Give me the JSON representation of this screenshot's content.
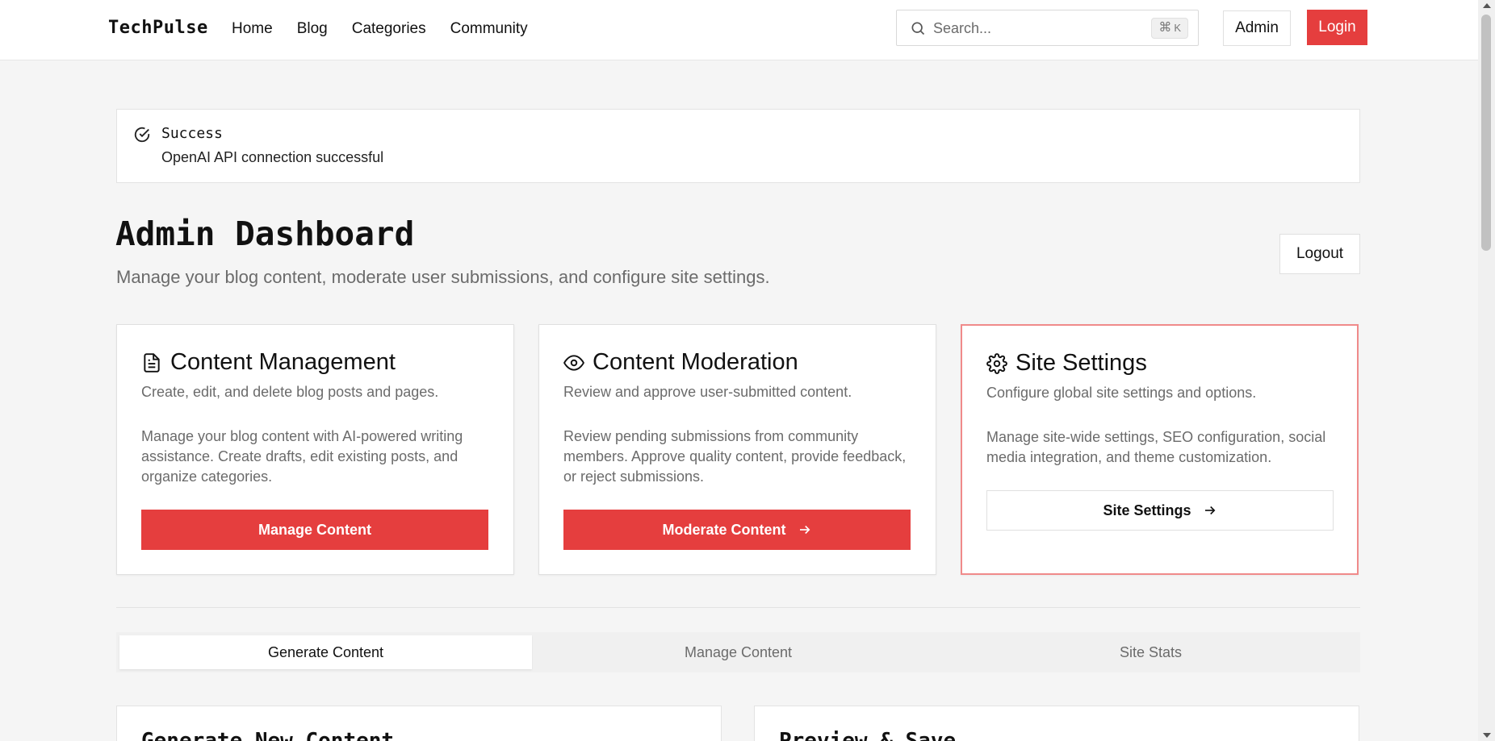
{
  "header": {
    "brand": "TechPulse",
    "nav": [
      "Home",
      "Blog",
      "Categories",
      "Community"
    ],
    "search_placeholder": "Search...",
    "shortcut_key": "K",
    "admin_label": "Admin",
    "login_label": "Login"
  },
  "alert": {
    "title": "Success",
    "message": "OpenAI API connection successful"
  },
  "page": {
    "title": "Admin Dashboard",
    "subtitle": "Manage your blog content, moderate user submissions, and configure site settings.",
    "logout_label": "Logout"
  },
  "cards": [
    {
      "title": "Content Management",
      "desc": "Create, edit, and delete blog posts and pages.",
      "body": "Manage your blog content with AI-powered writing assistance. Create drafts, edit existing posts, and organize categories.",
      "button": "Manage Content"
    },
    {
      "title": "Content Moderation",
      "desc": "Review and approve user-submitted content.",
      "body": "Review pending submissions from community members. Approve quality content, provide feedback, or reject submissions.",
      "button": "Moderate Content"
    },
    {
      "title": "Site Settings",
      "desc": "Configure global site settings and options.",
      "body": "Manage site-wide settings, SEO configuration, social media integration, and theme customization.",
      "button": "Site Settings"
    }
  ],
  "tabs": [
    "Generate Content",
    "Manage Content",
    "Site Stats"
  ],
  "panels": [
    "Generate New Content",
    "Preview & Save"
  ],
  "colors": {
    "accent": "#e53e3e",
    "accent_border": "#f08a8a",
    "background": "#f5f5f5"
  },
  "icons": {
    "search": "search-icon",
    "success": "check-circle-icon",
    "doc": "file-text-icon",
    "eye": "eye-icon",
    "gear": "gear-icon",
    "arrow": "arrow-right-icon"
  }
}
